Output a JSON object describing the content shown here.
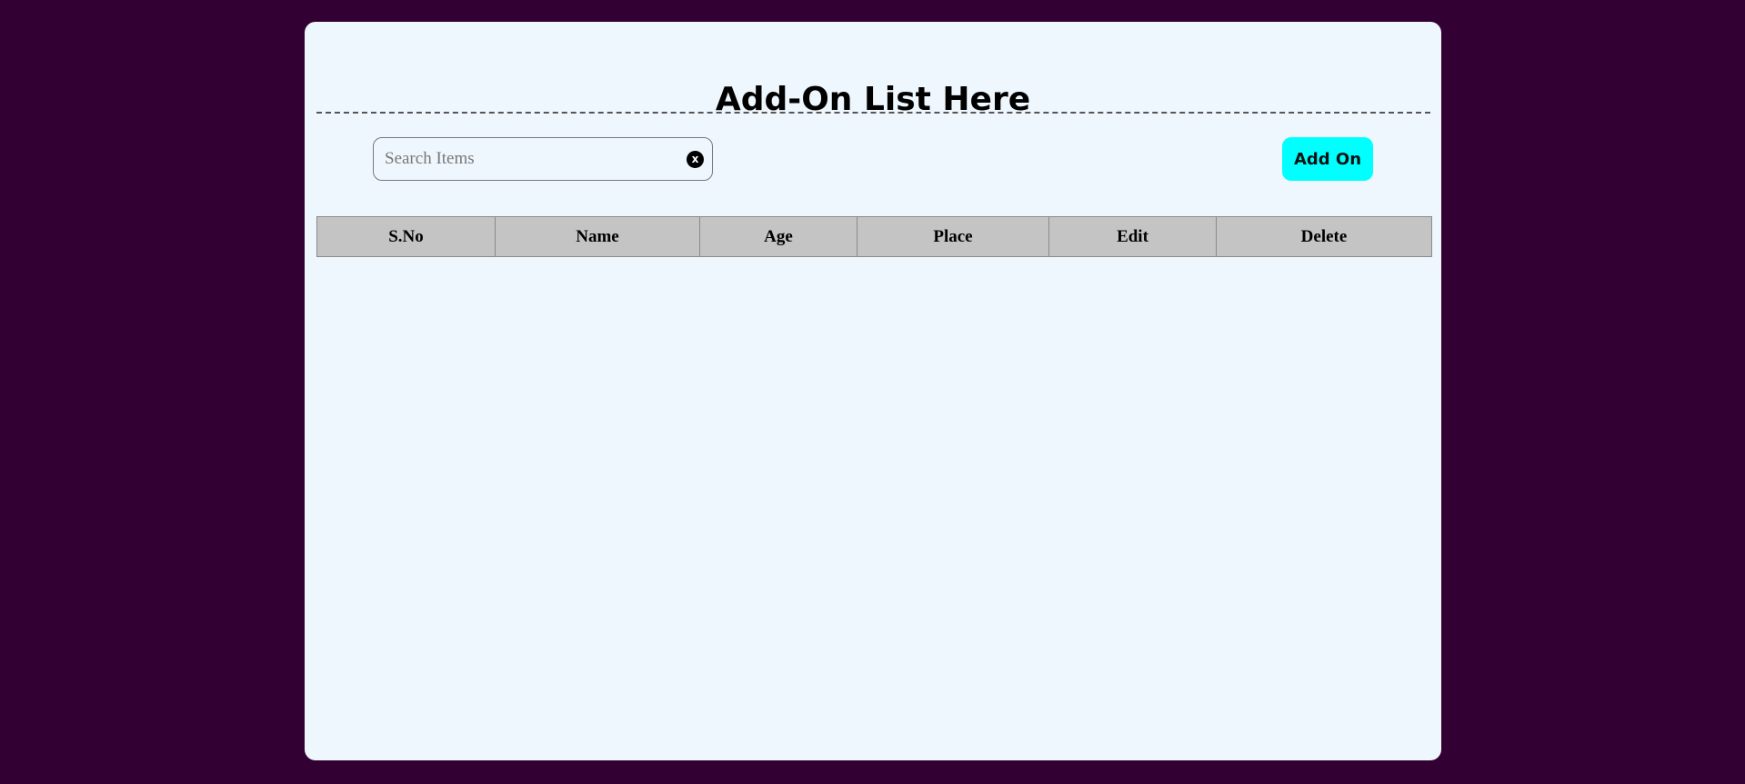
{
  "page": {
    "title": "Add-On List Here"
  },
  "search": {
    "placeholder": "Search Items",
    "value": "",
    "clear_glyph": "x",
    "clear_icon": "close-circle-icon"
  },
  "toolbar": {
    "add_label": "Add On"
  },
  "table": {
    "headers": [
      "S.No",
      "Name",
      "Age",
      "Place",
      "Edit",
      "Delete"
    ],
    "rows": []
  },
  "colors": {
    "background": "#330033",
    "card": "#eff7fe",
    "accent_button": "#00ffff",
    "table_header": "#c4c4c4"
  }
}
